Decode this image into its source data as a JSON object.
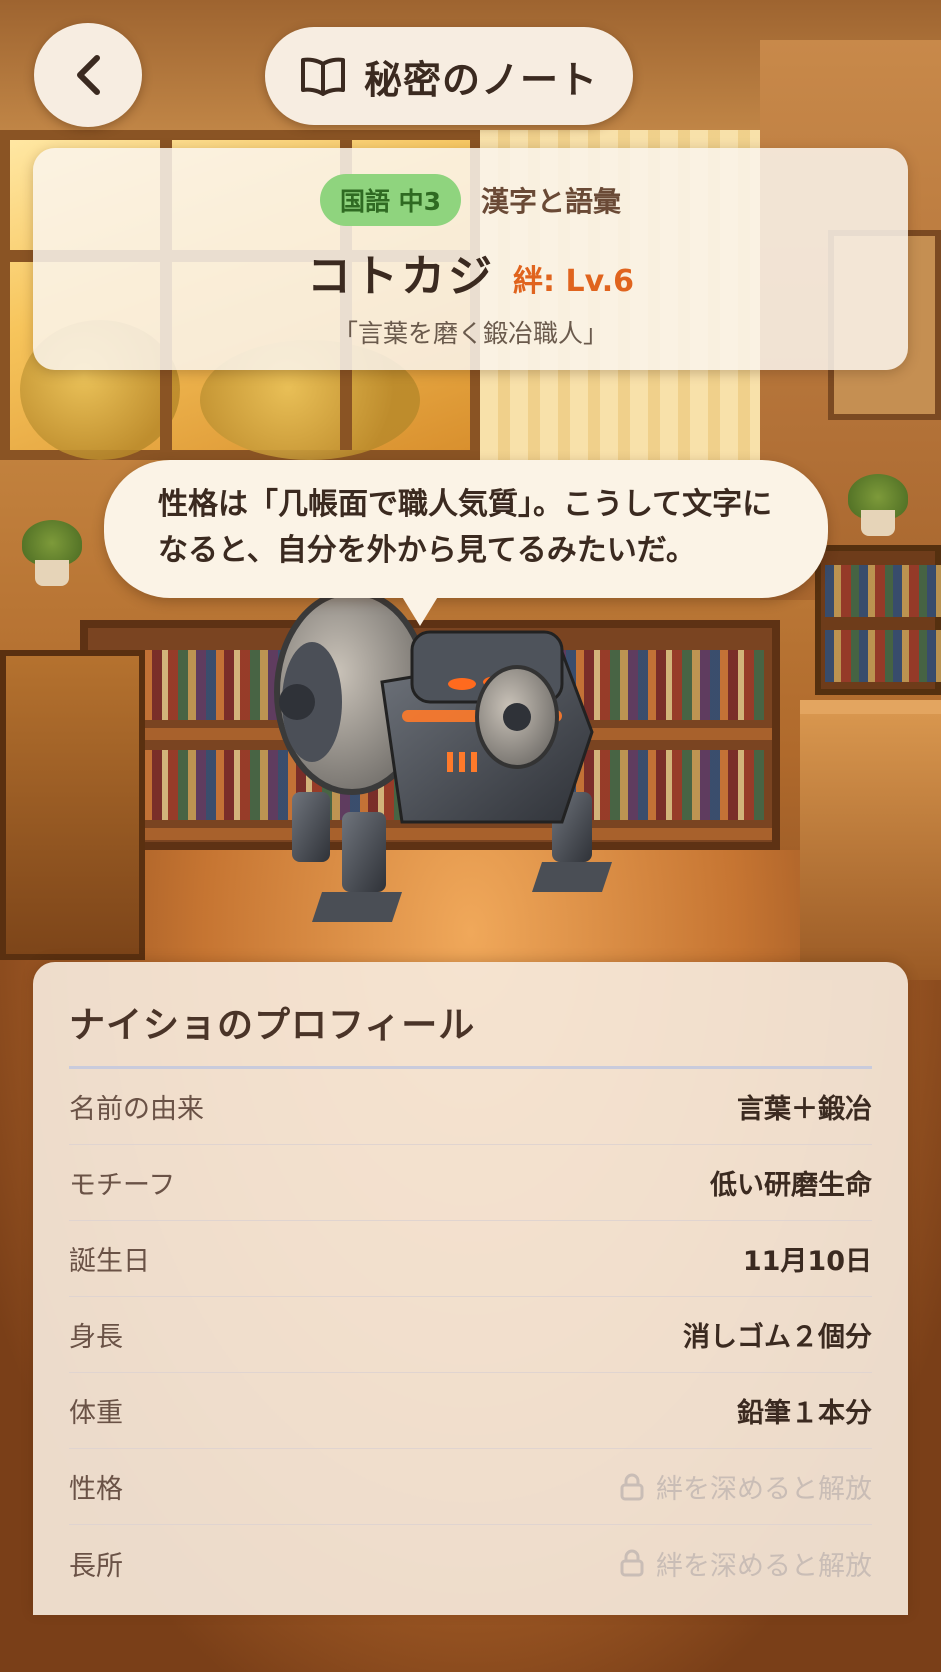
{
  "header": {
    "back_icon": "chevron-left-icon",
    "title_icon": "open-book-icon",
    "title": "秘密のノート"
  },
  "character": {
    "subject_badge": "国語 中3",
    "topic": "漢字と語彙",
    "name": "コトカジ",
    "bond": "絆: Lv.6",
    "epithet": "「言葉を磨く鍛冶職人」",
    "speech": "性格は「几帳面で職人気質」。こうして文字になると、自分を外から見てるみたいだ。"
  },
  "profile": {
    "title": "ナイショのプロフィール",
    "rows": [
      {
        "label": "名前の由来",
        "value": "言葉＋鍛冶"
      },
      {
        "label": "モチーフ",
        "value": "低い研磨生命"
      },
      {
        "label": "誕生日",
        "value": "11月10日"
      },
      {
        "label": "身長",
        "value": "消しゴム２個分"
      },
      {
        "label": "体重",
        "value": "鉛筆１本分"
      },
      {
        "label": "性格",
        "value": "絆を深めると解放",
        "locked": true
      },
      {
        "label": "長所",
        "value": "絆を深めると解放",
        "locked": true
      }
    ],
    "lock_icon": "lock-icon"
  },
  "colors": {
    "accent": "#e0641e",
    "badge_bg": "#8fd47e",
    "badge_text": "#2f6a22"
  }
}
